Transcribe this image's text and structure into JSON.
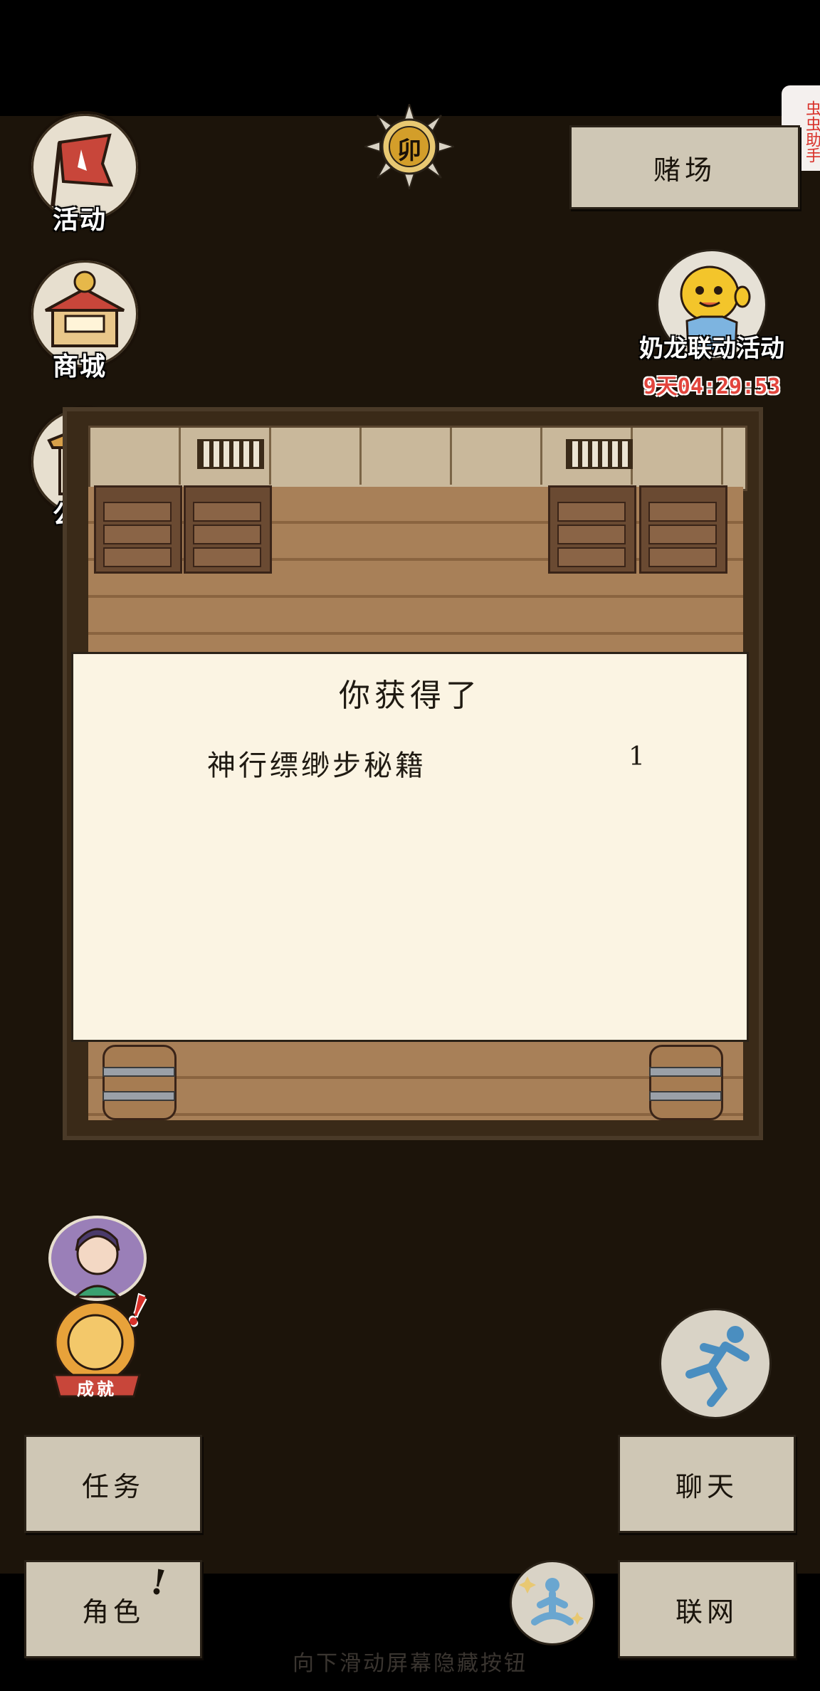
{
  "top_menu": {
    "activity_label": "活动",
    "shop_label": "商城",
    "notice_label": "公告"
  },
  "time_badge": {
    "char": "卯"
  },
  "helper_tab": {
    "label": "虫虫助手"
  },
  "casino_button": {
    "label": "赌场"
  },
  "event": {
    "title": "奶龙联动活动",
    "timer": "9天04:29:53"
  },
  "dialog": {
    "title": "你获得了",
    "rewards": [
      {
        "name": "神行缥缈步秘籍",
        "qty": "1"
      }
    ]
  },
  "achievement": {
    "label": "成就"
  },
  "bottom_buttons": {
    "task": "任务",
    "chat": "聊天",
    "role": "角色",
    "network": "联网"
  },
  "hint": "向下滑动屏幕隐藏按钮",
  "colors": {
    "background": "#1c140a",
    "paper_button": "#cfc7b5",
    "dialog_bg": "#fbf4e3",
    "timer_red": "#e2453d",
    "badge_red": "#d9312a"
  }
}
